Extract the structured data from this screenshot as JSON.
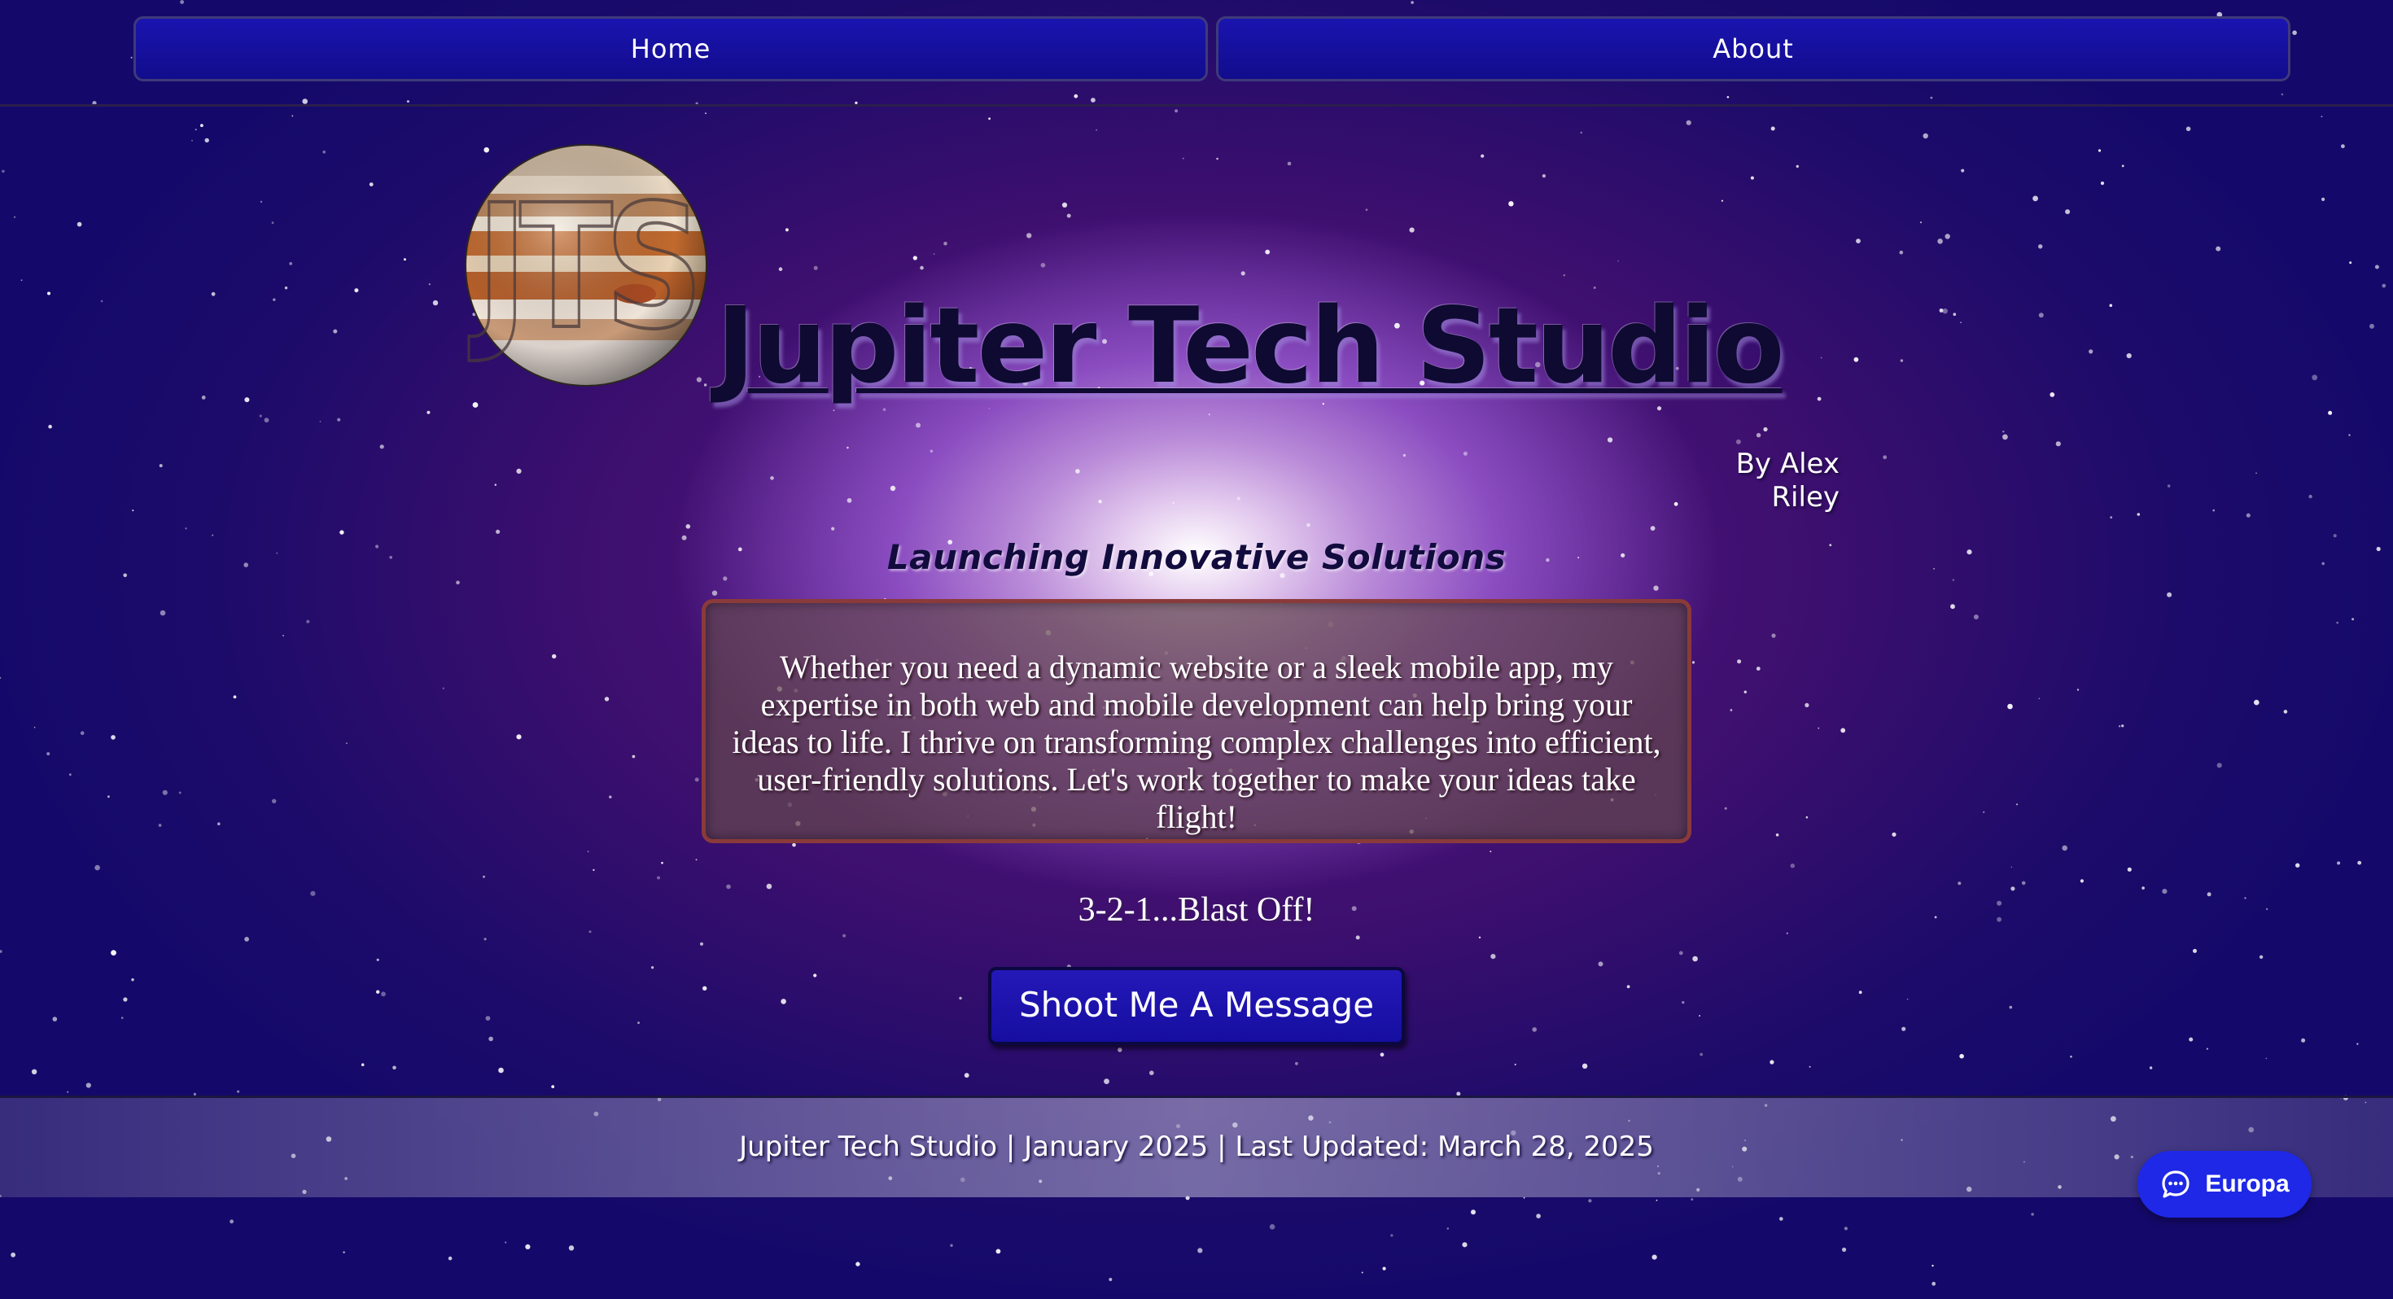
{
  "nav": {
    "home_label": "Home",
    "about_label": "About"
  },
  "header": {
    "logo_letters": "JTS",
    "title": "Jupiter Tech Studio",
    "byline": "By Alex Riley"
  },
  "main": {
    "tagline": "Launching Innovative Solutions",
    "about_text": "Whether you need a dynamic website or a sleek mobile app, my expertise in both web and mobile development can help bring your ideas to life. I thrive on transforming complex challenges into efficient, user-friendly solutions. Let's work together to make your ideas take flight!",
    "countdown": "3-2-1...Blast Off!",
    "cta_label": "Shoot Me A Message"
  },
  "footer": {
    "text": "Jupiter Tech Studio | January 2025 | Last Updated: March 28, 2025"
  },
  "chat_widget": {
    "label": "Europa",
    "icon": "chat-bubble-icon"
  },
  "colors": {
    "nav_button": "#1a14b0",
    "cta_button": "#2418b8",
    "title_text": "#0e0a32",
    "about_box_border": "#8a3a3a",
    "chat_button": "#1e28e6"
  }
}
